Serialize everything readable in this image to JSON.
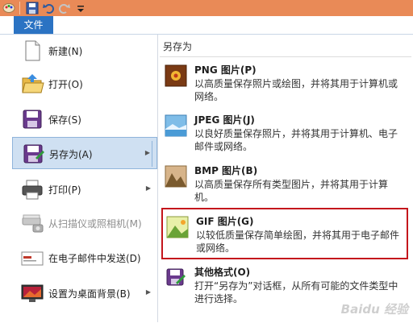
{
  "file_tab": "文件",
  "left_menu": [
    {
      "label": "新建(N)",
      "icon": "new-document-icon"
    },
    {
      "label": "打开(O)",
      "icon": "open-folder-icon"
    },
    {
      "label": "保存(S)",
      "icon": "save-disk-icon"
    },
    {
      "label": "另存为(A)",
      "icon": "save-as-icon"
    },
    {
      "label": "打印(P)",
      "icon": "printer-icon"
    },
    {
      "label": "从扫描仪或照相机(M)",
      "icon": "scanner-icon"
    },
    {
      "label": "在电子邮件中发送(D)",
      "icon": "email-icon"
    },
    {
      "label": "设置为桌面背景(B)",
      "icon": "desktop-background-icon"
    }
  ],
  "save_as": {
    "heading": "另存为",
    "items": [
      {
        "title": "PNG 图片(P)",
        "desc": "以高质量保存照片或绘图，并将其用于计算机或网络。",
        "icon": "png-image-icon"
      },
      {
        "title": "JPEG 图片(J)",
        "desc": "以良好质量保存照片，并将其用于计算机、电子邮件或网络。",
        "icon": "jpeg-image-icon"
      },
      {
        "title": "BMP 图片(B)",
        "desc": "以高质量保存所有类型图片，并将其用于计算机。",
        "icon": "bmp-image-icon"
      },
      {
        "title": "GIF 图片(G)",
        "desc": "以较低质量保存简单绘图，并将其用于电子邮件或网络。",
        "icon": "gif-image-icon"
      },
      {
        "title": "其他格式(O)",
        "desc": "打开“另存为”对话框，从所有可能的文件类型中进行选择。",
        "icon": "other-formats-icon"
      }
    ]
  },
  "watermark": "Baidu 经验",
  "colors": {
    "title_bar": "#e98a57",
    "file_tab": "#2b73c3",
    "selection": "#cfe0f2",
    "highlight_border": "#c4161c"
  }
}
